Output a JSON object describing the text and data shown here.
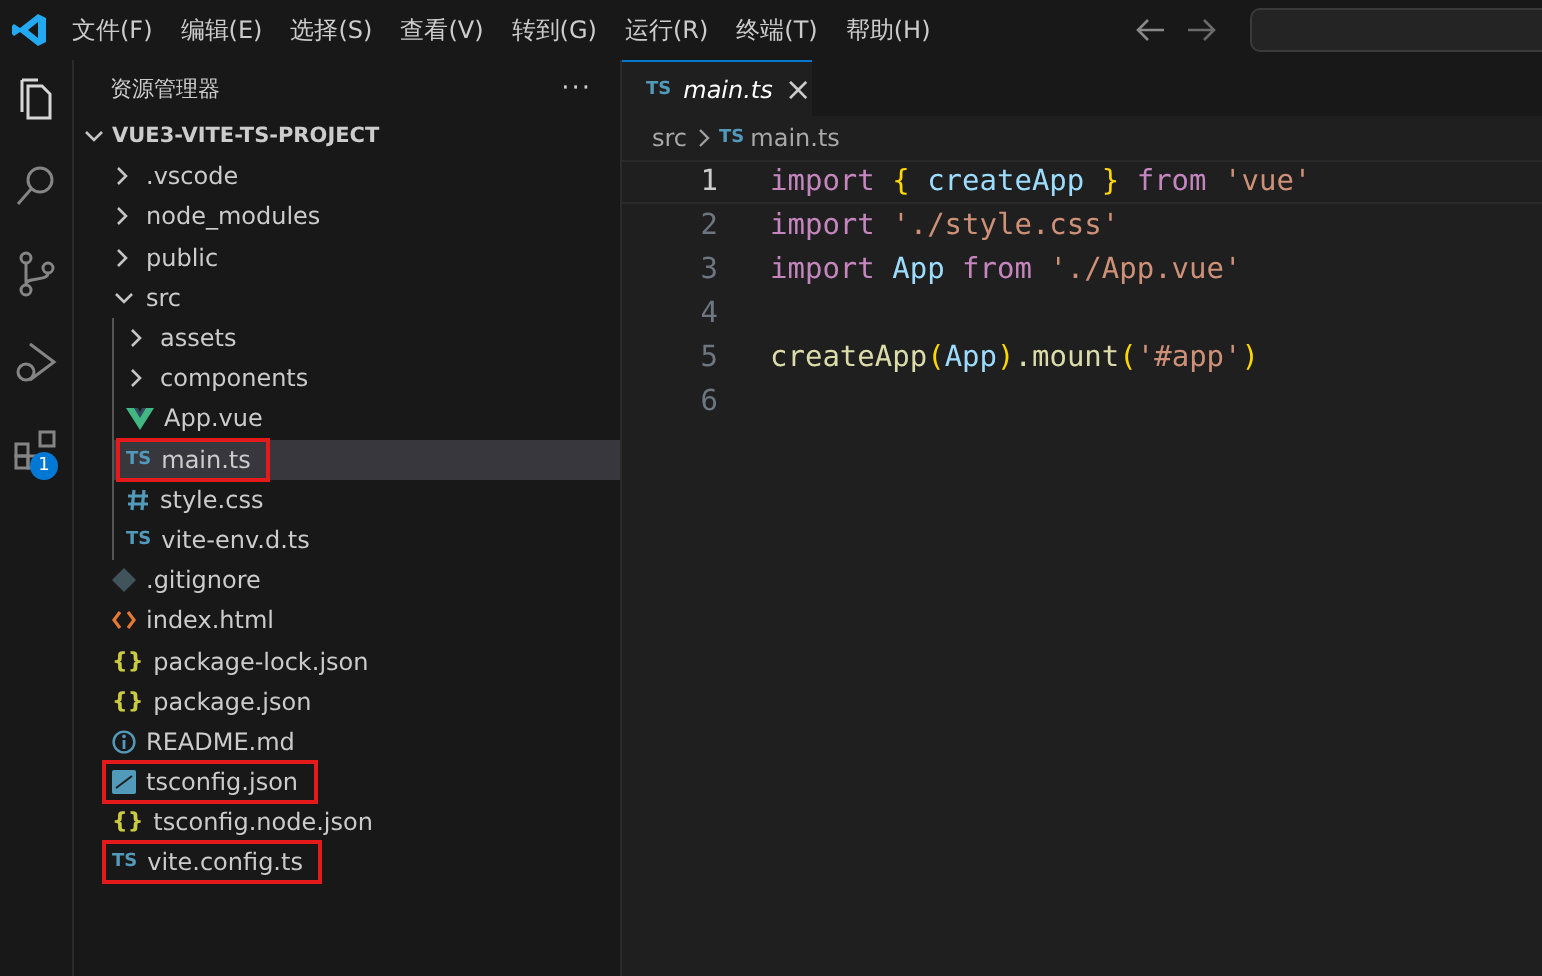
{
  "menu": [
    "文件(F)",
    "编辑(E)",
    "选择(S)",
    "查看(V)",
    "转到(G)",
    "运行(R)",
    "终端(T)",
    "帮助(H)"
  ],
  "activity_bar": {
    "extensions_badge": "1"
  },
  "explorer": {
    "title": "资源管理器",
    "more": "···",
    "root": {
      "label": "VUE3-VITE-TS-PROJECT",
      "expanded": true
    },
    "tree": [
      {
        "label": ".vscode",
        "kind": "folder",
        "expanded": false,
        "selected": false,
        "highlighted": false
      },
      {
        "label": "node_modules",
        "kind": "folder",
        "expanded": false,
        "selected": false,
        "highlighted": false
      },
      {
        "label": "public",
        "kind": "folder",
        "expanded": false,
        "selected": false,
        "highlighted": false
      },
      {
        "label": "src",
        "kind": "folder",
        "expanded": true,
        "selected": false,
        "highlighted": false,
        "children": [
          {
            "label": "assets",
            "kind": "folder",
            "expanded": false,
            "selected": false,
            "highlighted": false
          },
          {
            "label": "components",
            "kind": "folder",
            "expanded": false,
            "selected": false,
            "highlighted": false
          },
          {
            "label": "App.vue",
            "kind": "vue",
            "selected": false,
            "highlighted": false
          },
          {
            "label": "main.ts",
            "kind": "ts",
            "icon": "TS",
            "selected": true,
            "highlighted": true
          },
          {
            "label": "style.css",
            "kind": "css",
            "selected": false,
            "highlighted": false
          },
          {
            "label": "vite-env.d.ts",
            "kind": "ts",
            "icon": "TS",
            "selected": false,
            "highlighted": false
          }
        ]
      },
      {
        "label": ".gitignore",
        "kind": "git",
        "selected": false,
        "highlighted": false
      },
      {
        "label": "index.html",
        "kind": "html",
        "selected": false,
        "highlighted": false
      },
      {
        "label": "package-lock.json",
        "kind": "json",
        "icon": "{}",
        "selected": false,
        "highlighted": false
      },
      {
        "label": "package.json",
        "kind": "json",
        "icon": "{}",
        "selected": false,
        "highlighted": false
      },
      {
        "label": "README.md",
        "kind": "info",
        "selected": false,
        "highlighted": false
      },
      {
        "label": "tsconfig.json",
        "kind": "tsconfig",
        "selected": false,
        "highlighted": true
      },
      {
        "label": "tsconfig.node.json",
        "kind": "json",
        "icon": "{}",
        "selected": false,
        "highlighted": false
      },
      {
        "label": "vite.config.ts",
        "kind": "ts",
        "icon": "TS",
        "selected": false,
        "highlighted": true
      }
    ]
  },
  "editor": {
    "tabs": [
      {
        "label": "main.ts",
        "kind": "ts",
        "icon": "TS",
        "selected": true,
        "close": "×"
      }
    ],
    "breadcrumb": [
      {
        "label": "src",
        "kind": "folder"
      },
      {
        "label": "main.ts",
        "kind": "ts",
        "icon": "TS"
      }
    ],
    "lines": [
      {
        "number": "1",
        "selected": true,
        "tokens": [
          {
            "text": "import ",
            "kind": "keyword"
          },
          {
            "text": "{",
            "kind": "bracket"
          },
          {
            "text": " createApp ",
            "kind": "variable"
          },
          {
            "text": "}",
            "kind": "bracket"
          },
          {
            "text": " from ",
            "kind": "keyword"
          },
          {
            "text": "'vue'",
            "kind": "string"
          }
        ]
      },
      {
        "number": "2",
        "selected": false,
        "tokens": [
          {
            "text": "import ",
            "kind": "keyword"
          },
          {
            "text": "'./style.css'",
            "kind": "string"
          }
        ]
      },
      {
        "number": "3",
        "selected": false,
        "tokens": [
          {
            "text": "import ",
            "kind": "keyword"
          },
          {
            "text": "App",
            "kind": "variable"
          },
          {
            "text": " from ",
            "kind": "keyword"
          },
          {
            "text": "'./App.vue'",
            "kind": "string"
          }
        ]
      },
      {
        "number": "4",
        "selected": false
      },
      {
        "number": "5",
        "selected": false,
        "tokens": [
          {
            "text": "createApp",
            "kind": "function"
          },
          {
            "text": "(",
            "kind": "bracket"
          },
          {
            "text": "App",
            "kind": "variable"
          },
          {
            "text": ")",
            "kind": "bracket"
          },
          {
            "text": ".mount",
            "kind": "function"
          },
          {
            "text": "(",
            "kind": "bracket"
          },
          {
            "text": "'#app'",
            "kind": "string"
          },
          {
            "text": ")",
            "kind": "bracket"
          }
        ]
      },
      {
        "number": "6",
        "selected": false
      }
    ]
  }
}
